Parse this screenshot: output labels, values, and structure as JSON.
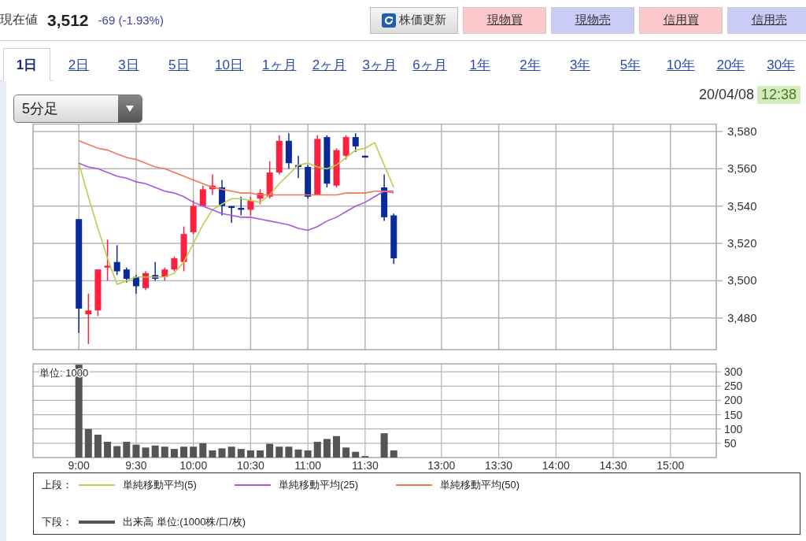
{
  "quote": {
    "label": "現在値",
    "price": "3,512",
    "change": "-69 (-1.93%)"
  },
  "actions": [
    {
      "label": "株価更新",
      "kind": "refresh"
    },
    {
      "label": "現物買",
      "kind": "buy"
    },
    {
      "label": "現物売",
      "kind": "sell"
    },
    {
      "label": "信用買",
      "kind": "buy"
    },
    {
      "label": "信用売",
      "kind": "sell"
    }
  ],
  "period_tabs": [
    {
      "label": "1日",
      "selected": true
    },
    {
      "label": "2日",
      "selected": false
    },
    {
      "label": "3日",
      "selected": false
    },
    {
      "label": "5日",
      "selected": false
    },
    {
      "label": "10日",
      "selected": false
    },
    {
      "label": "1ヶ月",
      "selected": false
    },
    {
      "label": "2ヶ月",
      "selected": false
    },
    {
      "label": "3ヶ月",
      "selected": false
    },
    {
      "label": "6ヶ月",
      "selected": false
    },
    {
      "label": "1年",
      "selected": false
    },
    {
      "label": "2年",
      "selected": false
    },
    {
      "label": "3年",
      "selected": false
    },
    {
      "label": "5年",
      "selected": false
    },
    {
      "label": "10年",
      "selected": false
    },
    {
      "label": "20年",
      "selected": false
    },
    {
      "label": "30年",
      "selected": false
    }
  ],
  "interval_select": {
    "value": "5分足"
  },
  "timestamp": {
    "date": "20/04/08",
    "time": "12:38"
  },
  "upper_label": "上段：",
  "lower_label": "下段：",
  "price_chart": {
    "chart_data": {
      "type": "candlestick",
      "grid": true,
      "categories": [
        null,
        null,
        null,
        null,
        null,
        null,
        null,
        null,
        null,
        null,
        null,
        null,
        null,
        null,
        null,
        null,
        null,
        null,
        null,
        null,
        null,
        null,
        null,
        null,
        null,
        null,
        null,
        null,
        null,
        null,
        null,
        null,
        null,
        null,
        null,
        null,
        null,
        null,
        null,
        null,
        null,
        null,
        null,
        null,
        null,
        null,
        null,
        null,
        null,
        null,
        null,
        null,
        null,
        null,
        null,
        null,
        null,
        null,
        null,
        null,
        null,
        null,
        null,
        null,
        null,
        null,
        null
      ],
      "ylim": [
        3463,
        3584
      ],
      "yticks": [
        {
          "value": 3480,
          "label": "3,480"
        },
        {
          "value": 3500,
          "label": "3,500"
        },
        {
          "value": 3520,
          "label": "3,520"
        },
        {
          "value": 3540,
          "label": "3,540"
        },
        {
          "value": 3560,
          "label": "3,560"
        },
        {
          "value": 3580,
          "label": "3,580"
        }
      ],
      "series": [
        {
          "name": "単純移動平均(5)",
          "type": "line",
          "color": "#b8d050",
          "values": [
            3563,
            3545,
            3528,
            3512,
            3498,
            3500,
            3502,
            3502,
            3502,
            3502,
            3504,
            3510,
            3520,
            3530,
            3538,
            3541,
            3544,
            3544,
            3543,
            3542,
            3546,
            3552,
            3557,
            3562,
            3563,
            3561,
            3560,
            3562,
            3566,
            3570,
            3571,
            3574,
            3562,
            3550,
            null,
            null,
            null,
            null,
            null,
            null,
            null,
            null,
            null,
            null,
            null,
            null,
            null,
            null,
            null,
            null,
            null,
            null,
            null,
            null,
            null,
            null,
            null,
            null,
            null,
            null,
            null,
            null,
            null,
            null,
            null,
            null,
            null
          ]
        },
        {
          "name": "単純移動平均(25)",
          "type": "line",
          "color": "#a855e0",
          "values": [
            3563,
            3561,
            3560,
            3558,
            3556,
            3555,
            3553,
            3552,
            3550,
            3548,
            3547,
            3545,
            3542,
            3540,
            3538,
            3536,
            3535,
            3534,
            3534,
            3533,
            3532,
            3531,
            3530,
            3528,
            3527,
            3529,
            3532,
            3534,
            3537,
            3540,
            3542,
            3545,
            3548,
            3548,
            null,
            null,
            null,
            null,
            null,
            null,
            null,
            null,
            null,
            null,
            null,
            null,
            null,
            null,
            null,
            null,
            null,
            null,
            null,
            null,
            null,
            null,
            null,
            null,
            null,
            null,
            null,
            null,
            null,
            null,
            null,
            null,
            null
          ]
        },
        {
          "name": "単純移動平均(50)",
          "type": "line",
          "color": "#f07858",
          "values": [
            3575,
            3573,
            3571,
            3570,
            3568,
            3566,
            3565,
            3563,
            3561,
            3560,
            3558,
            3556,
            3554,
            3552,
            3550,
            3549,
            3548,
            3547,
            3547,
            3546,
            3546,
            3546,
            3546,
            3546,
            3546,
            3546,
            3546,
            3546,
            3547,
            3547,
            3547,
            3548,
            3548,
            3547,
            null,
            null,
            null,
            null,
            null,
            null,
            null,
            null,
            null,
            null,
            null,
            null,
            null,
            null,
            null,
            null,
            null,
            null,
            null,
            null,
            null,
            null,
            null,
            null,
            null,
            null,
            null,
            null,
            null,
            null,
            null,
            null,
            null
          ]
        }
      ],
      "ohlc": [
        [
          3533,
          3533,
          3472,
          3485
        ],
        [
          3482,
          3493,
          3466,
          3484
        ],
        [
          3484,
          3506,
          3481,
          3506
        ],
        [
          3507,
          3522,
          3500,
          3508
        ],
        [
          3510,
          3519,
          3503,
          3505
        ],
        [
          3506,
          3507,
          3499,
          3501
        ],
        [
          3502,
          3503,
          3493,
          3497
        ],
        [
          3496,
          3505,
          3495,
          3504
        ],
        [
          3503,
          3510,
          3500,
          3501
        ],
        [
          3502,
          3507,
          3500,
          3506
        ],
        [
          3506,
          3513,
          3505,
          3512
        ],
        [
          3510,
          3529,
          3505,
          3525
        ],
        [
          3526,
          3543,
          3525,
          3540
        ],
        [
          3540,
          3551,
          3540,
          3549
        ],
        [
          3549,
          3557,
          3546,
          3551
        ],
        [
          3550,
          3554,
          3535,
          3540
        ],
        [
          3540,
          3540,
          3531,
          3539
        ],
        [
          3539,
          3545,
          3535,
          3538
        ],
        [
          3538,
          3545,
          3535,
          3543
        ],
        [
          3544,
          3549,
          3541,
          3547
        ],
        [
          3545,
          3564,
          3544,
          3558
        ],
        [
          3558,
          3578,
          3557,
          3575
        ],
        [
          3575,
          3579,
          3560,
          3563
        ],
        [
          3562,
          3567,
          3555,
          3561
        ],
        [
          3561,
          3562,
          3544,
          3545
        ],
        [
          3546,
          3578,
          3546,
          3576
        ],
        [
          3577,
          3578,
          3550,
          3552
        ],
        [
          3551,
          3571,
          3550,
          3570
        ],
        [
          3567,
          3578,
          3565,
          3577
        ],
        [
          3577,
          3579,
          3569,
          3572
        ],
        [
          3567,
          3567,
          3566,
          3566
        ],
        null,
        [
          3550,
          3557,
          3532,
          3534
        ],
        [
          3535,
          3536,
          3509,
          3512
        ],
        null,
        null,
        null,
        null,
        null,
        null,
        null,
        null,
        null,
        null,
        null,
        null,
        null,
        null,
        null,
        null,
        null,
        null,
        null,
        null,
        null,
        null,
        null,
        null,
        null,
        null,
        null,
        null,
        null,
        null,
        null,
        null,
        null
      ]
    }
  },
  "volume_chart": {
    "unit_label": "単位: 1000",
    "chart_data": {
      "type": "bar",
      "grid": true,
      "categories": [
        "9:00",
        null,
        null,
        null,
        null,
        null,
        "9:30",
        null,
        null,
        null,
        null,
        null,
        "10:00",
        null,
        null,
        null,
        null,
        null,
        "10:30",
        null,
        null,
        null,
        null,
        null,
        "11:00",
        null,
        null,
        null,
        null,
        null,
        "11:30",
        null,
        null,
        null,
        null,
        null,
        null,
        null,
        "13:00",
        null,
        null,
        null,
        null,
        null,
        "13:30",
        null,
        null,
        null,
        null,
        null,
        "14:00",
        null,
        null,
        null,
        null,
        null,
        "14:30",
        null,
        null,
        null,
        null,
        null,
        "15:00",
        null,
        null,
        null,
        null
      ],
      "ylim": [
        0,
        328
      ],
      "yticks": [
        50,
        100,
        150,
        200,
        250,
        300
      ],
      "series": [
        {
          "name": "出来高 単位:(1000株/口/枚)",
          "color": "#555555",
          "values": [
            325,
            100,
            80,
            55,
            40,
            55,
            45,
            35,
            42,
            38,
            30,
            38,
            38,
            50,
            25,
            32,
            38,
            30,
            25,
            25,
            48,
            38,
            38,
            28,
            25,
            55,
            65,
            75,
            35,
            20,
            5,
            null,
            85,
            25,
            null,
            null,
            null,
            null,
            null,
            null,
            null,
            null,
            null,
            null,
            null,
            null,
            null,
            null,
            null,
            null,
            null,
            null,
            null,
            null,
            null,
            null,
            null,
            null,
            null,
            null,
            null,
            null,
            null,
            null,
            null,
            null,
            null
          ]
        }
      ]
    }
  }
}
